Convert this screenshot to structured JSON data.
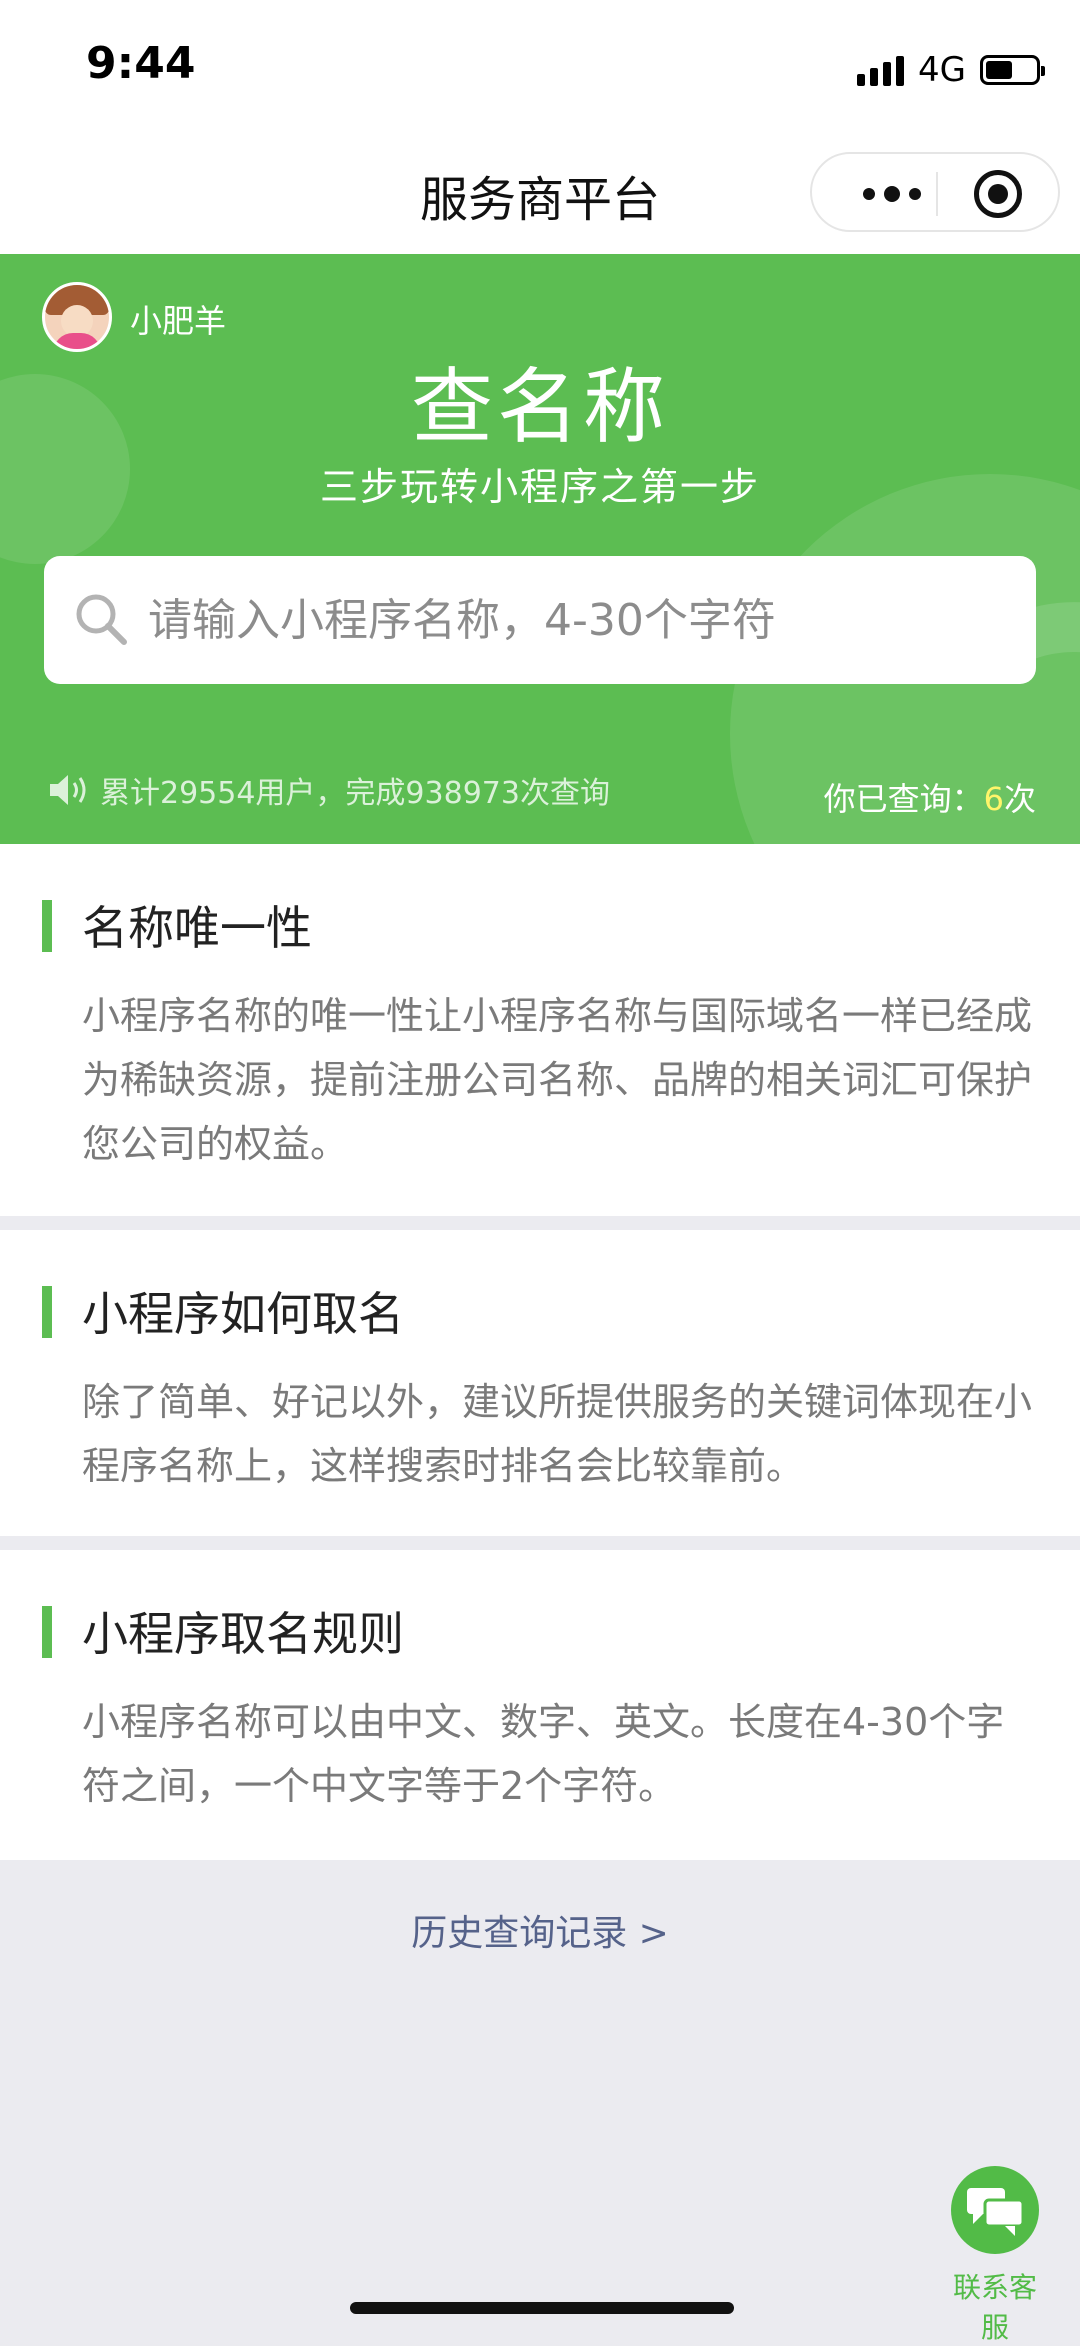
{
  "status_bar": {
    "time": "9:44",
    "network": "4G",
    "battery_level": 0.55
  },
  "nav": {
    "title": "服务商平台"
  },
  "hero": {
    "username": "小肥羊",
    "title": "查名称",
    "subtitle": "三步玩转小程序之第一步",
    "search_placeholder": "请输入小程序名称，4-30个字符",
    "stats_text": "累计29554用户，完成938973次查询",
    "query_label": "你已查询：",
    "query_count": "6",
    "query_unit": "次"
  },
  "sections": [
    {
      "title": "名称唯一性",
      "body": "小程序名称的唯一性让小程序名称与国际域名一样已经成为稀缺资源，提前注册公司名称、品牌的相关词汇可保护您公司的权益。"
    },
    {
      "title": "小程序如何取名",
      "body": "除了简单、好记以外，建议所提供服务的关键词体现在小程序名称上，这样搜索时排名会比较靠前。"
    },
    {
      "title": "小程序取名规则",
      "body": "小程序名称可以由中文、数字、英文。长度在4-30个字符之间，一个中文字等于2个字符。"
    }
  ],
  "history_link": "历史查询记录 >",
  "customer_service": {
    "label": "联系客服"
  },
  "colors": {
    "brand_green": "#5cbd52",
    "count_highlight": "#fff56a",
    "link": "#55628a"
  },
  "icons": [
    "more-icon",
    "close-miniprogram-icon",
    "search-icon",
    "speaker-icon",
    "chat-icon"
  ]
}
